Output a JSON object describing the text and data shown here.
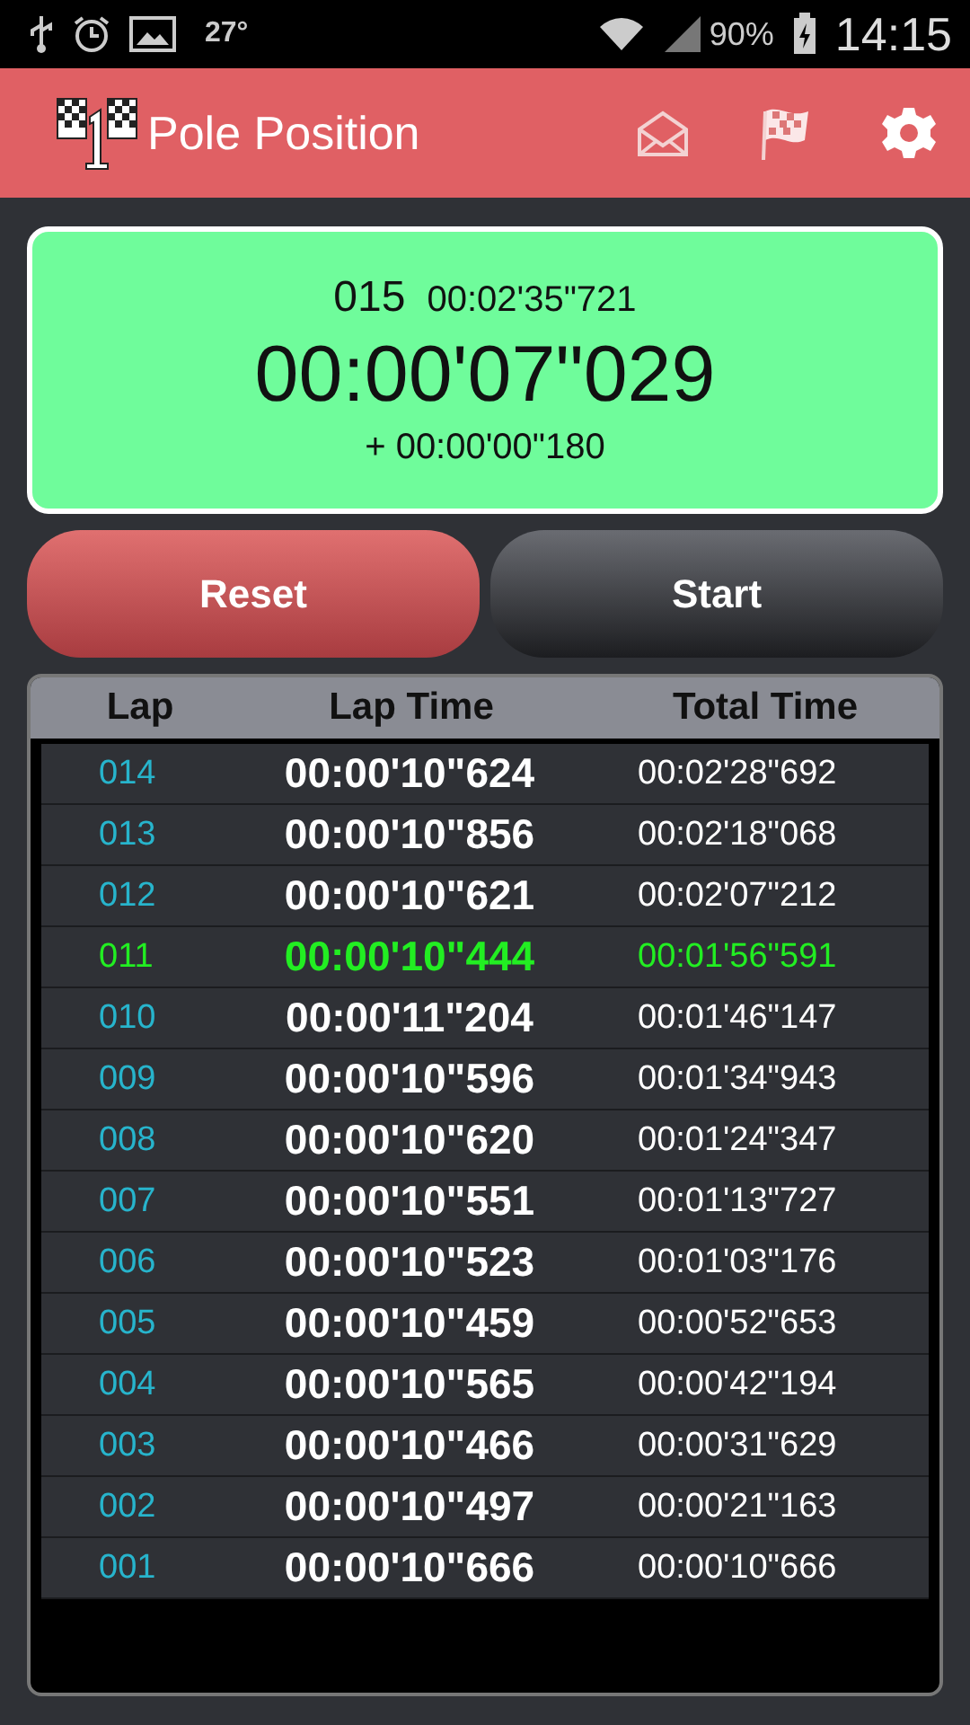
{
  "status_bar": {
    "temperature": "27°",
    "battery": "90%",
    "time": "14:15"
  },
  "app_bar": {
    "title": "Pole Position"
  },
  "timer": {
    "lap": "015",
    "total": "00:02'35\"721",
    "current": "00:00'07\"029",
    "delta": "+ 00:00'00\"180"
  },
  "buttons": [
    {
      "label": "Reset",
      "kind": "reset"
    },
    {
      "label": "Start",
      "kind": "start"
    }
  ],
  "table": {
    "columns": [
      "Lap",
      "Lap Time",
      "Total Time"
    ],
    "rows": [
      {
        "lap": "014",
        "lap_time": "00:00'10\"624",
        "total_time": "00:02'28\"692",
        "best": false
      },
      {
        "lap": "013",
        "lap_time": "00:00'10\"856",
        "total_time": "00:02'18\"068",
        "best": false
      },
      {
        "lap": "012",
        "lap_time": "00:00'10\"621",
        "total_time": "00:02'07\"212",
        "best": false
      },
      {
        "lap": "011",
        "lap_time": "00:00'10\"444",
        "total_time": "00:01'56\"591",
        "best": true
      },
      {
        "lap": "010",
        "lap_time": "00:00'11\"204",
        "total_time": "00:01'46\"147",
        "best": false
      },
      {
        "lap": "009",
        "lap_time": "00:00'10\"596",
        "total_time": "00:01'34\"943",
        "best": false
      },
      {
        "lap": "008",
        "lap_time": "00:00'10\"620",
        "total_time": "00:01'24\"347",
        "best": false
      },
      {
        "lap": "007",
        "lap_time": "00:00'10\"551",
        "total_time": "00:01'13\"727",
        "best": false
      },
      {
        "lap": "006",
        "lap_time": "00:00'10\"523",
        "total_time": "00:01'03\"176",
        "best": false
      },
      {
        "lap": "005",
        "lap_time": "00:00'10\"459",
        "total_time": "00:00'52\"653",
        "best": false
      },
      {
        "lap": "004",
        "lap_time": "00:00'10\"565",
        "total_time": "00:00'42\"194",
        "best": false
      },
      {
        "lap": "003",
        "lap_time": "00:00'10\"466",
        "total_time": "00:00'31\"629",
        "best": false
      },
      {
        "lap": "002",
        "lap_time": "00:00'10\"497",
        "total_time": "00:00'21\"163",
        "best": false
      },
      {
        "lap": "001",
        "lap_time": "00:00'10\"666",
        "total_time": "00:00'10\"666",
        "best": false
      }
    ]
  }
}
